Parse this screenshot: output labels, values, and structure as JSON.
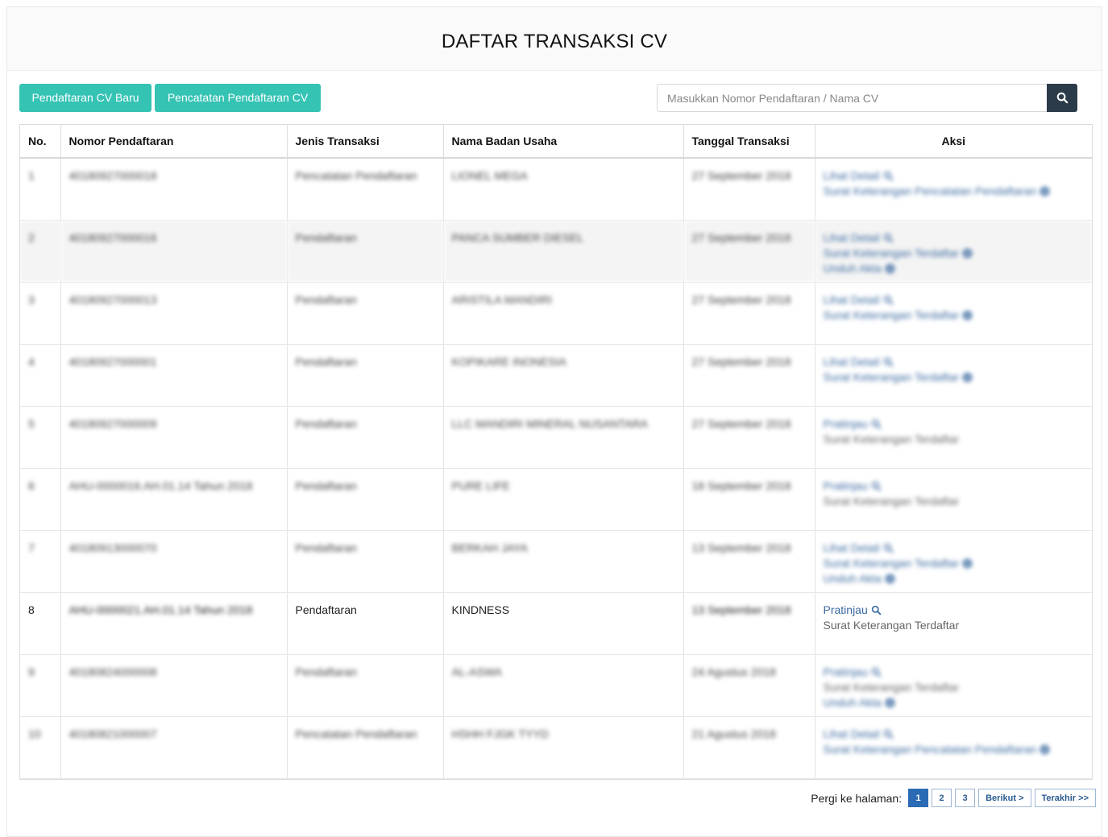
{
  "page": {
    "title": "DAFTAR TRANSAKSI CV"
  },
  "toolbar": {
    "new_label": "Pendaftaran CV Baru",
    "record_label": "Pencatatan Pendaftaran CV",
    "search_placeholder": "Masukkan Nomor Pendaftaran / Nama CV"
  },
  "table": {
    "headers": [
      "No.",
      "Nomor Pendaftaran",
      "Jenis Transaksi",
      "Nama Badan Usaha",
      "Tanggal Transaksi",
      "Aksi"
    ],
    "rows": [
      {
        "no": "1",
        "nomor": "40180927000018",
        "jenis": "Pencatatan Pendaftaran",
        "nama": "LIONEL MEGA",
        "tanggal": "27 September 2018",
        "actions": [
          {
            "label": "Lihat Detail",
            "type": "link",
            "icon": "search-icon"
          },
          {
            "label": "Surat Keterangan Pencatatan Pendaftaran",
            "type": "link",
            "icon": "download-icon"
          }
        ]
      },
      {
        "no": "2",
        "nomor": "40180927000016",
        "jenis": "Pendaftaran",
        "nama": "PANCA SUMBER DIESEL",
        "tanggal": "27 September 2018",
        "actions": [
          {
            "label": "Lihat Detail",
            "type": "link",
            "icon": "search-icon"
          },
          {
            "label": "Surat Keterangan Terdaftar",
            "type": "link",
            "icon": "download-icon"
          },
          {
            "label": "Unduh Akta",
            "type": "link",
            "icon": "download-icon"
          }
        ]
      },
      {
        "no": "3",
        "nomor": "40180927000013",
        "jenis": "Pendaftaran",
        "nama": "ARISTILA MANDIRI",
        "tanggal": "27 September 2018",
        "actions": [
          {
            "label": "Lihat Detail",
            "type": "link",
            "icon": "search-icon"
          },
          {
            "label": "Surat Keterangan Terdaftar",
            "type": "link",
            "icon": "download-icon"
          }
        ]
      },
      {
        "no": "4",
        "nomor": "40180927000001",
        "jenis": "Pendaftaran",
        "nama": "KOPIKARE INONESIA",
        "tanggal": "27 September 2018",
        "actions": [
          {
            "label": "Lihat Detail",
            "type": "link",
            "icon": "search-icon"
          },
          {
            "label": "Surat Keterangan Terdaftar",
            "type": "link",
            "icon": "download-icon"
          }
        ]
      },
      {
        "no": "5",
        "nomor": "40180927000009",
        "jenis": "Pendaftaran",
        "nama": "LLC MANDIRI MINERAL NUSANTARA",
        "tanggal": "27 September 2018",
        "actions": [
          {
            "label": "Pratinjau",
            "type": "link",
            "icon": "search-icon"
          },
          {
            "label": "Surat Keterangan Terdaftar",
            "type": "plain",
            "icon": ""
          }
        ]
      },
      {
        "no": "6",
        "nomor": "AHU-0000016.AH.01.14 Tahun 2018",
        "jenis": "Pendaftaran",
        "nama": "PURE LIFE",
        "tanggal": "18 September 2018",
        "actions": [
          {
            "label": "Pratinjau",
            "type": "link",
            "icon": "search-icon"
          },
          {
            "label": "Surat Keterangan Terdaftar",
            "type": "plain",
            "icon": ""
          }
        ]
      },
      {
        "no": "7",
        "nomor": "40180913000070",
        "jenis": "Pendaftaran",
        "nama": "BERKAH JAYA",
        "tanggal": "13 September 2018",
        "actions": [
          {
            "label": "Lihat Detail",
            "type": "link",
            "icon": "search-icon"
          },
          {
            "label": "Surat Keterangan Terdaftar",
            "type": "link",
            "icon": "download-icon"
          },
          {
            "label": "Unduh Akta",
            "type": "link",
            "icon": "download-icon"
          }
        ]
      },
      {
        "no": "8",
        "nomor": "AHU-0000021.AH.01.14 Tahun 2018",
        "jenis": "Pendaftaran",
        "nama": "KINDNESS",
        "tanggal": "13 September 2018",
        "actions": [
          {
            "label": "Pratinjau",
            "type": "link",
            "icon": "search-icon"
          },
          {
            "label": "Surat Keterangan Terdaftar",
            "type": "plain",
            "icon": ""
          }
        ]
      },
      {
        "no": "9",
        "nomor": "40180824000008",
        "jenis": "Pendaftaran",
        "nama": "AL-ASWA",
        "tanggal": "24 Agustus 2018",
        "actions": [
          {
            "label": "Pratinjau",
            "type": "link",
            "icon": "search-icon"
          },
          {
            "label": "Surat Keterangan Terdaftar",
            "type": "plain",
            "icon": ""
          },
          {
            "label": "Unduh Akta",
            "type": "link",
            "icon": "download-icon"
          }
        ]
      },
      {
        "no": "10",
        "nomor": "40180821000007",
        "jenis": "Pencatatan Pendaftaran",
        "nama": "HSHH FJGK TYYD",
        "tanggal": "21 Agustus 2018",
        "actions": [
          {
            "label": "Lihat Detail",
            "type": "link",
            "icon": "search-icon"
          },
          {
            "label": "Surat Keterangan Pencatatan Pendaftaran",
            "type": "link",
            "icon": "download-icon"
          }
        ]
      }
    ]
  },
  "pagination": {
    "label": "Pergi ke halaman:",
    "pages": [
      "1",
      "2",
      "3"
    ],
    "current": "1",
    "next_label": "Berikut >",
    "last_label": "Terakhir >>"
  },
  "colors": {
    "teal": "#35c3b4",
    "search_button": "#2b3b4a",
    "link": "#3b6aa0",
    "page_active": "#2b6bb3"
  }
}
